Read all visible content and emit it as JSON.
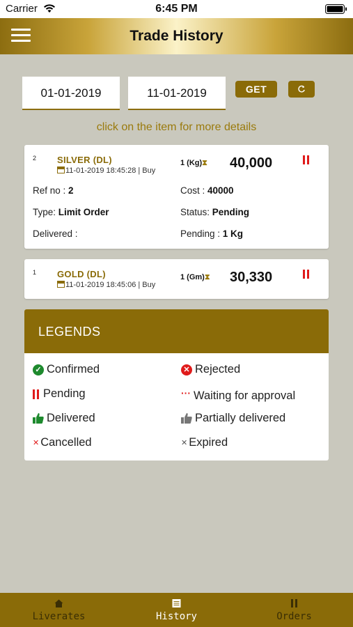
{
  "status_bar": {
    "carrier": "Carrier",
    "time": "6:45 PM"
  },
  "header": {
    "title": "Trade History",
    "menu_icon": "hamburger-menu-icon"
  },
  "filter": {
    "from_date": "01-01-2019",
    "to_date": "11-01-2019",
    "get_label": "GET",
    "refresh_icon": "refresh-icon"
  },
  "hint": "click on the item for more details",
  "trades": [
    {
      "index": "2",
      "name": "SILVER (DL)",
      "date": "11-01-2019 18:45:28 | Buy",
      "qty": "1 (Kg)",
      "price": "40,000",
      "status_icon": "pending-icon",
      "details": {
        "ref_label": "Ref no : ",
        "ref_value": "2",
        "cost_label": "Cost : ",
        "cost_value": "40000",
        "type_label": "Type: ",
        "type_value": "Limit Order",
        "status_label": "Status: ",
        "status_value": "Pending",
        "delivered_label": "Delivered :",
        "delivered_value": "",
        "pending_label": "Pending : ",
        "pending_value": "1 Kg"
      }
    },
    {
      "index": "1",
      "name": "GOLD (DL)",
      "date": "11-01-2019 18:45:06 | Buy",
      "qty": "1 (Gm)",
      "price": "30,330",
      "status_icon": "pending-icon"
    }
  ],
  "legends": {
    "title": "LEGENDS",
    "items": [
      {
        "label": "Confirmed",
        "icon": "check-circle-icon",
        "color": "#1e8a2e"
      },
      {
        "label": "Rejected",
        "icon": "x-circle-icon",
        "color": "#e01b1b"
      },
      {
        "label": "Pending",
        "icon": "pause-icon",
        "color": "#e01b1b"
      },
      {
        "label": "Waiting for approval",
        "icon": "dots-icon",
        "color": "#e01b1b"
      },
      {
        "label": "Delivered",
        "icon": "thumbs-up-icon",
        "color": "#1e8a2e"
      },
      {
        "label": "Partially delivered",
        "icon": "thumbs-up-icon",
        "color": "#777777"
      },
      {
        "label": "Cancelled",
        "icon": "x-icon",
        "color": "#e01b1b"
      },
      {
        "label": "Expired",
        "icon": "x-icon",
        "color": "#555555"
      }
    ]
  },
  "tabs": [
    {
      "label": "Liverates",
      "icon": "home-icon",
      "active": false
    },
    {
      "label": "History",
      "icon": "list-icon",
      "active": true
    },
    {
      "label": "Orders",
      "icon": "pause-icon",
      "active": false
    }
  ],
  "colors": {
    "accent": "#8a6b08",
    "background": "#c9c8bd",
    "red": "#e01b1b",
    "green": "#1e8a2e"
  }
}
